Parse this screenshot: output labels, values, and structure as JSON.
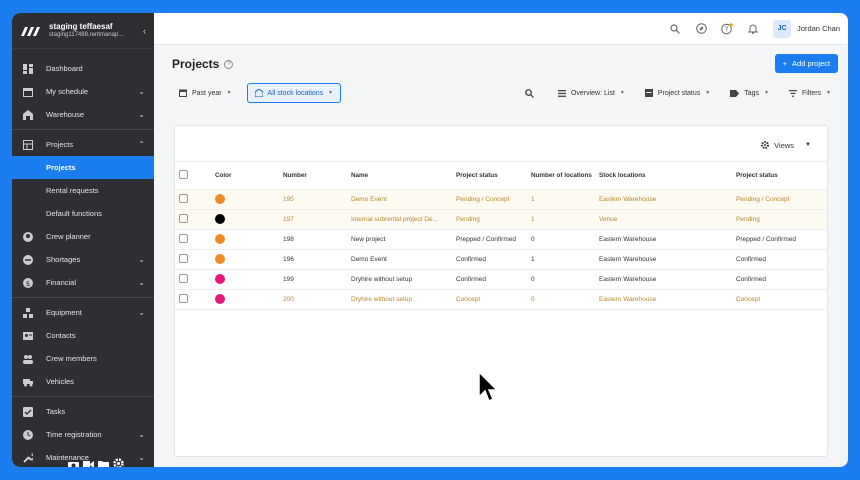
{
  "sidebar": {
    "org_name": "staging teffaesaf",
    "org_sub": "staging117488.rentmanap...",
    "items": [
      {
        "label": "Dashboard",
        "icon": "dashboard-icon",
        "chevron": false
      },
      {
        "label": "My schedule",
        "icon": "calendar-icon",
        "chevron": true
      },
      {
        "label": "Warehouse",
        "icon": "warehouse-icon",
        "chevron": true
      },
      {
        "label": "Projects",
        "icon": "projects-icon",
        "chevron": true
      },
      {
        "label": "Projects"
      },
      {
        "label": "Rental requests"
      },
      {
        "label": "Default functions"
      },
      {
        "label": "Crew planner",
        "icon": "person-icon"
      },
      {
        "label": "Shortages",
        "icon": "shortages-icon",
        "chevron": true
      },
      {
        "label": "Financial",
        "icon": "dollar-icon",
        "chevron": true
      },
      {
        "label": "Equipment",
        "icon": "equipment-icon",
        "chevron": true
      },
      {
        "label": "Contacts",
        "icon": "contacts-icon"
      },
      {
        "label": "Crew members",
        "icon": "crew-icon"
      },
      {
        "label": "Vehicles",
        "icon": "vehicle-icon"
      },
      {
        "label": "Tasks",
        "icon": "tasks-icon"
      },
      {
        "label": "Time registration",
        "icon": "clock-icon",
        "chevron": true
      },
      {
        "label": "Maintenance",
        "icon": "wrench-icon",
        "chevron": true
      }
    ]
  },
  "header": {
    "avatar_initials": "JC",
    "user_name": "Jordan Chan"
  },
  "page": {
    "title": "Projects",
    "add_button": "Add project"
  },
  "filters": {
    "period": "Past year",
    "locations": "All stock locations",
    "overview": "Overview: List",
    "status": "Project status",
    "tags": "Tags",
    "filters": "Filters"
  },
  "table": {
    "views_label": "Views",
    "headers": [
      "Color",
      "Number",
      "Name",
      "Project status",
      "Number of locations",
      "Stock locations",
      "Project status"
    ],
    "rows": [
      {
        "color": "#f08a24",
        "number": "195",
        "name": "Demo Event",
        "status": "Pending / Concept",
        "locations": "1",
        "stock": "Eastern Warehouse",
        "status2": "Pending / Concept",
        "highlight": true
      },
      {
        "color": "#000000",
        "number": "197",
        "name": "Internal subrental project De...",
        "status": "Pending",
        "locations": "1",
        "stock": "Venue",
        "status2": "Pending",
        "highlight": true
      },
      {
        "color": "#f08a24",
        "number": "198",
        "name": "New project",
        "status": "Prepped / Confirmed",
        "locations": "0",
        "stock": "Eastern Warehouse",
        "status2": "Prepped / Confirmed",
        "highlight": false
      },
      {
        "color": "#f08a24",
        "number": "196",
        "name": "Demo Event",
        "status": "Confirmed",
        "locations": "1",
        "stock": "Eastern Warehouse",
        "status2": "Confirmed",
        "highlight": false
      },
      {
        "color": "#e6167a",
        "number": "199",
        "name": "Dryhire without setup",
        "status": "Confirmed",
        "locations": "0",
        "stock": "Eastern Warehouse",
        "status2": "Confirmed",
        "highlight": false
      },
      {
        "color": "#e6167a",
        "number": "200",
        "name": "Dryhire without setup",
        "status": "Concept",
        "locations": "0",
        "stock": "Eastern Warehouse",
        "status2": "Concept",
        "highlight": false
      }
    ]
  },
  "colors": {
    "accent": "#1a7df0",
    "sidebar_bg": "#2d2f33",
    "link_text": "#b5882a"
  }
}
